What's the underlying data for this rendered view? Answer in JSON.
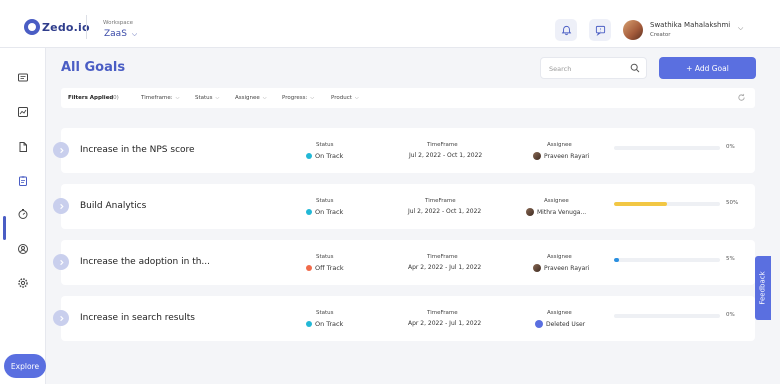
{
  "app": {
    "logo_text": "Zedo.io",
    "workspace_label": "Workspace",
    "workspace_value": "ZaaS"
  },
  "user": {
    "name": "Swathika Mahalakshmi",
    "role": "Creator"
  },
  "page": {
    "title": "All Goals",
    "search_placeholder": "Search",
    "add_goal_label": "+ Add Goal"
  },
  "filters": {
    "applied_label": "Filters Applied",
    "applied_count": "(0)",
    "items": [
      "Timeframe:",
      "Status",
      "Assignee",
      "Progress:",
      "Product"
    ]
  },
  "columns": {
    "status": "Status",
    "timeframe": "TimeFrame",
    "assignee": "Assignee"
  },
  "goals": [
    {
      "name": "Increase in the NPS score",
      "status": "On Track",
      "status_color": "#22b8d6",
      "timeframe": "Jul 2, 2022 - Oct 1, 2022",
      "assignee": "Praveen Rayari",
      "progress_pct": 0,
      "progress_label": "0%",
      "progress_color": "#22b8d6"
    },
    {
      "name": "Build Analytics",
      "status": "On Track",
      "status_color": "#22b8d6",
      "timeframe": "Jul 2, 2022 - Oct 1, 2022",
      "assignee": "Mithra Venuga...",
      "progress_pct": 50,
      "progress_label": "50%",
      "progress_color": "#f2c744"
    },
    {
      "name": "Increase the adoption in th...",
      "status": "Off Track",
      "status_color": "#f06a4a",
      "timeframe": "Apr 2, 2022 - Jul 1, 2022",
      "assignee": "Praveen Rayari",
      "progress_pct": 5,
      "progress_label": "5%",
      "progress_color": "#2a8fe0"
    },
    {
      "name": "Increase in search results",
      "status": "On Track",
      "status_color": "#22b8d6",
      "timeframe": "Apr 2, 2022 - Jul 1, 2022",
      "assignee": "Deleted User",
      "progress_pct": 0,
      "progress_label": "0%",
      "progress_color": "#22b8d6"
    }
  ],
  "sidebar": {
    "icons": [
      "messages-icon",
      "dashboard-chart-icon",
      "document-icon",
      "goals-clipboard-icon",
      "timer-icon",
      "user-support-icon",
      "settings-gear-icon"
    ],
    "explore_label": "Explore"
  },
  "feedback_label": "Feedback"
}
